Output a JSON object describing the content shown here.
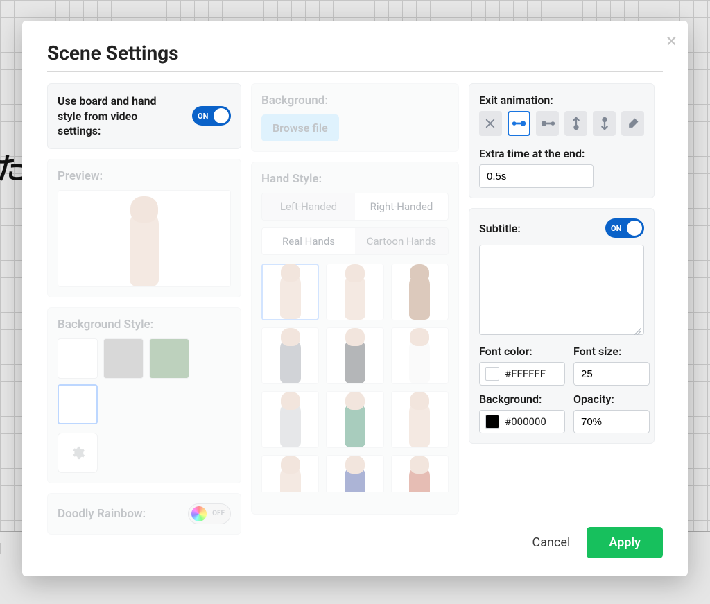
{
  "modal": {
    "title": "Scene Settings",
    "close_icon": "close-icon"
  },
  "left": {
    "use_board_label": "Use board and hand style from video settings:",
    "use_board_toggle": "ON",
    "preview_label": "Preview:",
    "background_style_label": "Background Style:",
    "swatches": [
      {
        "color": "#ffffff",
        "selected": false
      },
      {
        "color": "#a9a9a9",
        "selected": false
      },
      {
        "color": "#6f9a6e",
        "selected": false
      },
      {
        "color": "#ffffff",
        "selected": true
      }
    ],
    "doodly_rainbow_label": "Doodly Rainbow:",
    "rainbow_toggle": "OFF"
  },
  "mid": {
    "background_label": "Background:",
    "browse_label": "Browse file",
    "hand_style_label": "Hand Style:",
    "handedness": {
      "left": "Left-Handed",
      "right": "Right-Handed",
      "active": "right"
    },
    "hand_tabs": {
      "real": "Real Hands",
      "cartoon": "Cartoon Hands",
      "active": "real"
    },
    "hand_options": [
      {
        "skin": "light",
        "sleeve": null,
        "selected": true
      },
      {
        "skin": "light",
        "sleeve": null,
        "selected": false
      },
      {
        "skin": "dark",
        "sleeve": null,
        "selected": false
      },
      {
        "skin": "light",
        "sleeve": "#9aa0a7",
        "selected": false
      },
      {
        "skin": "light",
        "sleeve": "#5a5e63",
        "selected": false
      },
      {
        "skin": "light",
        "sleeve": "#f4f4f4",
        "selected": false
      },
      {
        "skin": "light",
        "sleeve": "#c9ccd0",
        "selected": false
      },
      {
        "skin": "light",
        "sleeve": "#3f8f6e",
        "selected": false
      },
      {
        "skin": "light",
        "sleeve": null,
        "selected": false
      },
      {
        "skin": "light",
        "sleeve": "#e8cfc0",
        "selected": false
      },
      {
        "skin": "light",
        "sleeve": "#4a5aa6",
        "selected": false
      },
      {
        "skin": "light",
        "sleeve": "#c96f5a",
        "selected": false
      }
    ]
  },
  "right": {
    "exit_label": "Exit animation:",
    "exit_icons": [
      "none",
      "swipe-left",
      "swipe-right",
      "up",
      "down",
      "erase"
    ],
    "exit_active_index": 1,
    "extra_time_label": "Extra time at the end:",
    "extra_time_value": "0.5s",
    "subtitle_label": "Subtitle:",
    "subtitle_toggle": "ON",
    "subtitle_text": "",
    "font_color_label": "Font color:",
    "font_color_value": "#FFFFFF",
    "font_size_label": "Font size:",
    "font_size_value": "25",
    "bg_label": "Background:",
    "bg_value": "#000000",
    "opacity_label": "Opacity:",
    "opacity_value": "70%"
  },
  "footer": {
    "cancel": "Cancel",
    "apply": "Apply"
  }
}
